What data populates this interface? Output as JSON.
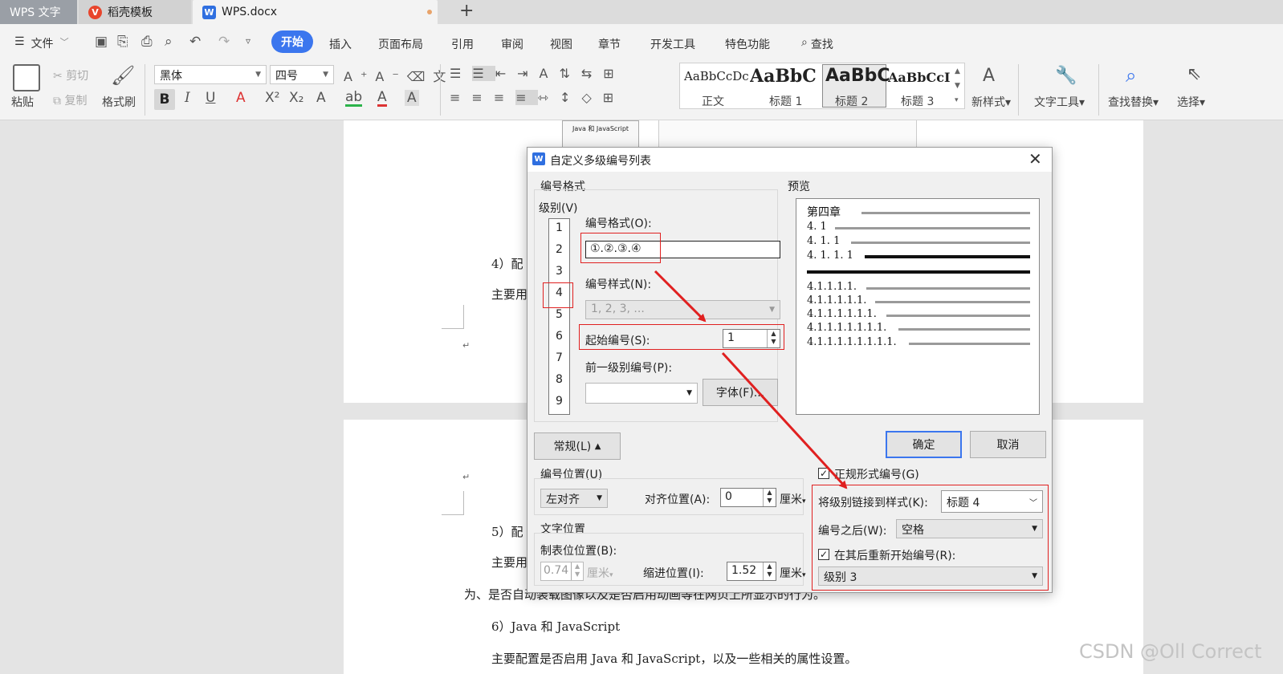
{
  "tabs": [
    {
      "label": "WPS 文字"
    },
    {
      "label": "稻壳模板"
    },
    {
      "label": "WPS.docx"
    }
  ],
  "new_tab_icon": "plus-icon",
  "menu": {
    "file": "文件",
    "items": [
      "开始",
      "插入",
      "页面布局",
      "引用",
      "审阅",
      "视图",
      "章节",
      "开发工具",
      "特色功能"
    ],
    "search": "查找"
  },
  "ribbon": {
    "paste": "粘贴",
    "cut": "剪切",
    "copy": "复制",
    "format_painter": "格式刷",
    "font_name": "黑体",
    "font_size": "四号",
    "styles": [
      {
        "sample": "AaBbCcDc",
        "label": "正文"
      },
      {
        "sample": "AaBbC",
        "label": "标题 1"
      },
      {
        "sample": "AaBbC",
        "label": "标题 2"
      },
      {
        "sample": "AaBbCcI",
        "label": "标题 3"
      }
    ],
    "new_style": "新样式",
    "text_tools": "文字工具",
    "find_replace": "查找替换",
    "select": "选择"
  },
  "document": {
    "image_caption": "Java 和 JavaScript",
    "line1_frag": "4）配",
    "line2_frag": "主要用",
    "line3_frag": "5）配",
    "line4_frag": "主要用",
    "line5": "为、是否自动装载图像以及是否启用动画等在网页上所显示的行为。",
    "line6": "6）Java 和 JavaScript",
    "line7": "主要配置是否启用 Java 和 JavaScript，以及一些相关的属性设置。"
  },
  "dialog": {
    "title": "自定义多级编号列表",
    "number_format_group": "编号格式",
    "level_label": "级别(V)",
    "levels": [
      "1",
      "2",
      "3",
      "4",
      "5",
      "6",
      "7",
      "8",
      "9"
    ],
    "selected_level": "4",
    "format_label": "编号格式(O):",
    "format_value": "①.②.③.④",
    "style_label": "编号样式(N):",
    "style_value": "1, 2, 3, ...",
    "start_label": "起始编号(S):",
    "start_value": "1",
    "prev_level_label": "前一级别编号(P):",
    "font_button": "字体(F)...",
    "preview_label": "预览",
    "preview_lines": [
      "第四章",
      "4. 1",
      "4. 1. 1",
      "4. 1. 1. 1",
      "4.1.1.1.1.",
      "4.1.1.1.1.1.",
      "4.1.1.1.1.1.1.",
      "4.1.1.1.1.1.1.1.",
      "4.1.1.1.1.1.1.1.1."
    ],
    "general_button": "常规(L)",
    "ok_button": "确定",
    "cancel_button": "取消",
    "position_group": "编号位置(U)",
    "align_value": "左对齐",
    "align_pos_label": "对齐位置(A):",
    "align_pos_value": "0",
    "unit": "厘米",
    "text_position_group": "文字位置",
    "tab_pos_label": "制表位位置(B):",
    "tab_pos_value": "0.74",
    "indent_label": "缩进位置(I):",
    "indent_value": "1.52",
    "legal_label": "正规形式编号(G)",
    "link_style_label": "将级别链接到样式(K):",
    "link_style_value": "标题 4",
    "after_label": "编号之后(W):",
    "after_value": "空格",
    "restart_label": "在其后重新开始编号(R):",
    "restart_value": "级别 3"
  },
  "watermark": "CSDN @Oll Correct",
  "colors": {
    "accent": "#3b76ee",
    "annotation": "#e02020"
  }
}
